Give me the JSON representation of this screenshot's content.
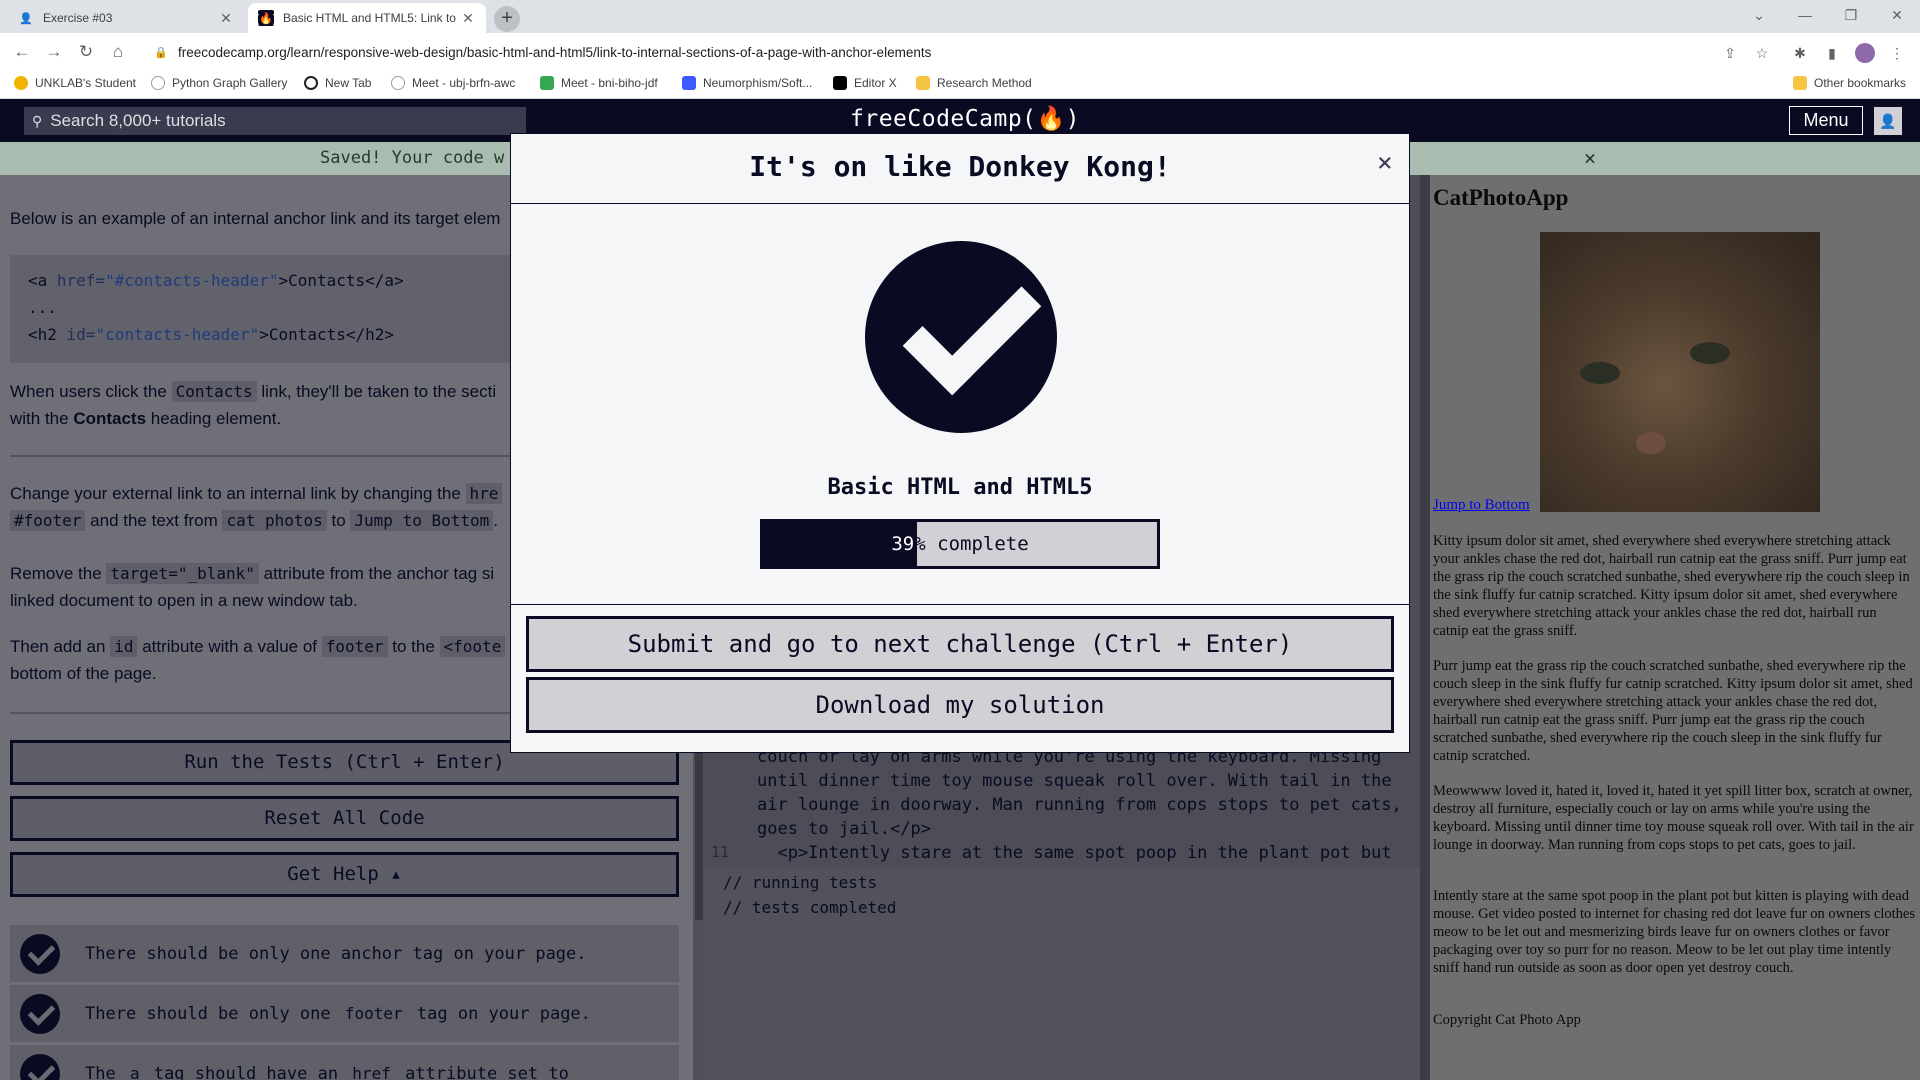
{
  "browser": {
    "tabs": [
      {
        "title": "Exercise #03",
        "active": false
      },
      {
        "title": "Basic HTML and HTML5: Link to",
        "active": true
      }
    ],
    "url": "freecodecamp.org/learn/responsive-web-design/basic-html-and-html5/link-to-internal-sections-of-a-page-with-anchor-elements",
    "bookmarks": [
      {
        "label": "UNKLAB's Student",
        "color": "#f0b400"
      },
      {
        "label": "Python Graph Gallery",
        "color": "#9aa0a6"
      },
      {
        "label": "New Tab",
        "color": "#202124"
      },
      {
        "label": "Meet - ubj-brfn-awc",
        "color": "#9aa0a6"
      },
      {
        "label": "Meet - bni-biho-jdf",
        "color": "#34a853"
      },
      {
        "label": "Neumorphism/Soft...",
        "color": "#3d5afe"
      },
      {
        "label": "Editor X",
        "color": "#000000"
      },
      {
        "label": "Research Method",
        "color": "#f6c445"
      }
    ],
    "other_bookmarks": "Other bookmarks"
  },
  "fcc": {
    "search_placeholder": "Search 8,000+ tutorials",
    "logo": "freeCodeCamp(🔥)",
    "menu": "Menu"
  },
  "flash": {
    "text": "Saved! Your code w",
    "close": "×"
  },
  "lesson": {
    "intro": "Below is an example of an internal anchor link and its target elem",
    "code_lines": [
      {
        "a": "<a ",
        "attr": "href=",
        "val": "\"#contacts-header\"",
        "rest": ">Contacts</a>"
      },
      {
        "a": "...",
        "attr": "",
        "val": "",
        "rest": ""
      },
      {
        "a": "<h2 ",
        "attr": "id=",
        "val": "\"contacts-header\"",
        "rest": ">Contacts</h2>"
      }
    ],
    "p2_a": "When users click the ",
    "p2_code": "Contacts",
    "p2_b": " link, they'll be taken to the secti",
    "p2_c": "with the ",
    "p2_bold": "Contacts",
    "p2_d": " heading element.",
    "p3_a": "Change your external link to an internal link by changing the ",
    "p3_code1": "hre",
    "p3_code2": "#footer",
    "p3_b": " and the text from ",
    "p3_code3": "cat photos",
    "p3_c": " to ",
    "p3_code4": "Jump to Bottom",
    "p3_d": ".",
    "p4_a": "Remove the ",
    "p4_code": "target=\"_blank\"",
    "p4_b": " attribute from the anchor tag si",
    "p4_c": "linked document to open in a new window tab.",
    "p5_a": "Then add an ",
    "p5_code1": "id",
    "p5_b": " attribute with a value of ",
    "p5_code2": "footer",
    "p5_c": " to the ",
    "p5_code3": "<foote",
    "p5_d": "bottom of the page."
  },
  "buttons": {
    "run": "Run the Tests (Ctrl + Enter)",
    "reset": "Reset All Code",
    "help": "Get Help ▴"
  },
  "tests": [
    {
      "pre": "There should be only one anchor tag on your page.",
      "code": "",
      "post": ""
    },
    {
      "pre": "There should be only one ",
      "code": "footer",
      "post": " tag on your page."
    },
    {
      "pre": "The ",
      "code": "a",
      "post": " tag should have an ",
      "code2": "href",
      "post2": " attribute set to"
    }
  ],
  "editor": {
    "lines": [
      {
        "num": "",
        "text": "couch or lay on arms while you're using the keyboard. Missing"
      },
      {
        "num": "",
        "text": "until dinner time toy mouse squeak roll over. With tail in the"
      },
      {
        "num": "",
        "text": "air lounge in doorway. Man running from cops stops to pet cats,"
      },
      {
        "num": "",
        "text": "goes to jail.</p>"
      },
      {
        "num": "11",
        "text": "  <p>Intently stare at the same spot poop in the plant pot but"
      }
    ]
  },
  "console": {
    "line1": "// running tests",
    "line2": "// tests completed"
  },
  "preview": {
    "title": "CatPhotoApp",
    "jump": "Jump to Bottom",
    "p1": "Kitty ipsum dolor sit amet, shed everywhere shed everywhere stretching attack your ankles chase the red dot, hairball run catnip eat the grass sniff. Purr jump eat the grass rip the couch scratched sunbathe, shed everywhere rip the couch sleep in the sink fluffy fur catnip scratched. Kitty ipsum dolor sit amet, shed everywhere shed everywhere stretching attack your ankles chase the red dot, hairball run catnip eat the grass sniff.",
    "p2": "Purr jump eat the grass rip the couch scratched sunbathe, shed everywhere rip the couch sleep in the sink fluffy fur catnip scratched. Kitty ipsum dolor sit amet, shed everywhere shed everywhere stretching attack your ankles chase the red dot, hairball run catnip eat the grass sniff. Purr jump eat the grass rip the couch scratched sunbathe, shed everywhere rip the couch sleep in the sink fluffy fur catnip scratched.",
    "p3": "Meowwww loved it, hated it, loved it, hated it yet spill litter box, scratch at owner, destroy all furniture, especially couch or lay on arms while you're using the keyboard. Missing until dinner time toy mouse squeak roll over. With tail in the air lounge in doorway. Man running from cops stops to pet cats, goes to jail.",
    "p4": "Intently stare at the same spot poop in the plant pot but kitten is playing with dead mouse. Get video posted to internet for chasing red dot leave fur on owners clothes meow to be let out and mesmerizing birds leave fur on owners clothes or favor packaging over toy so purr for no reason. Meow to be let out play time intently sniff hand run outside as soon as door open yet destroy couch.",
    "copyright": "Copyright Cat Photo App"
  },
  "modal": {
    "title": "It's on like Donkey Kong!",
    "close": "×",
    "superblock": "Basic HTML and HTML5",
    "progress_percent": 39,
    "progress_num": "39",
    "progress_suffix": "% complete",
    "submit": "Submit and go to next challenge (Ctrl + Enter)",
    "download": "Download my solution"
  }
}
